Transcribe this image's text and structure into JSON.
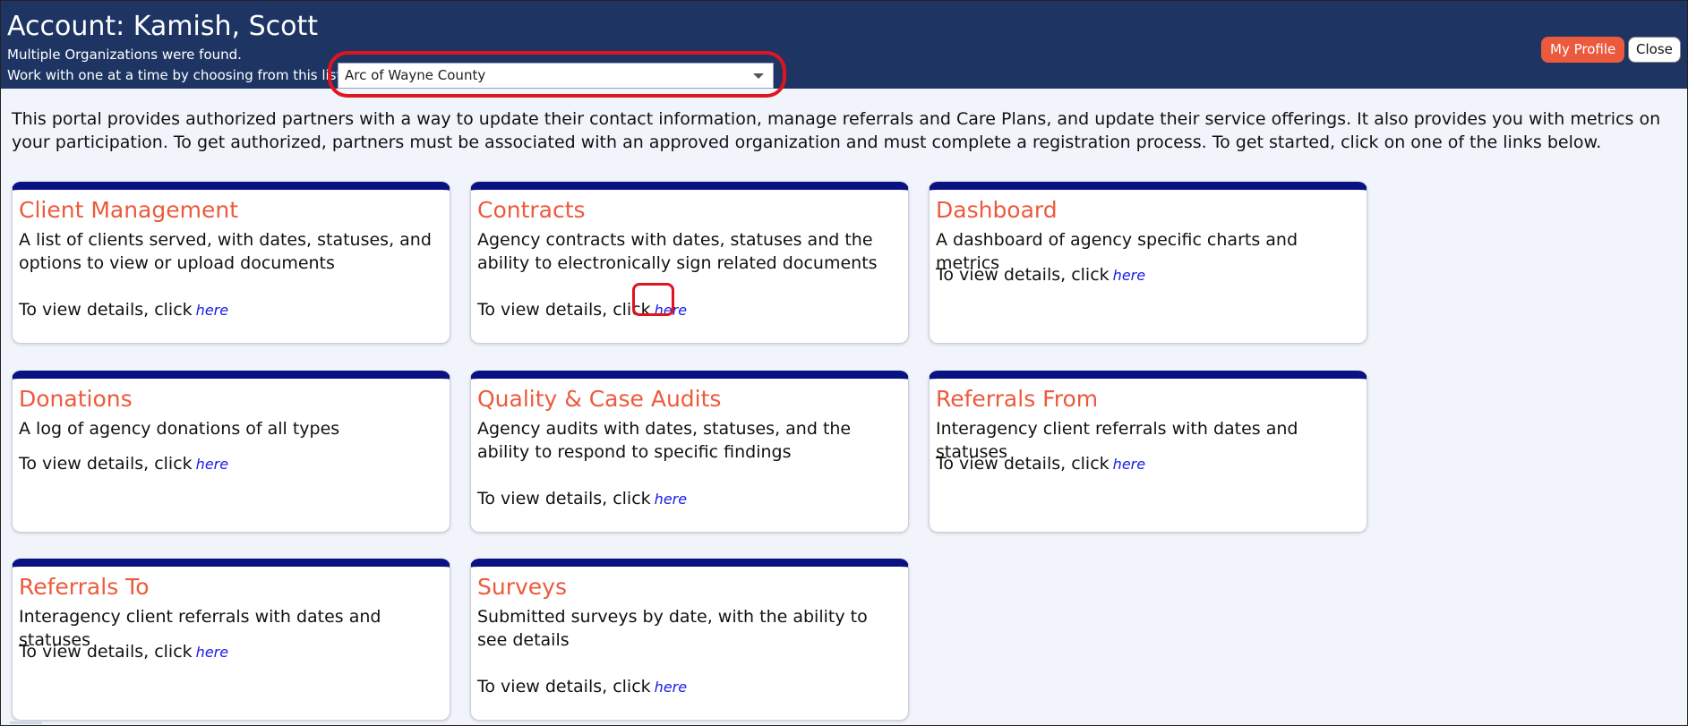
{
  "header": {
    "title": "Account: Kamish, Scott",
    "line1": "Multiple Organizations were found.",
    "line2": "Work with one at a time by choosing from this list",
    "org_select_value": "Arc of Wayne County",
    "my_profile_label": "My Profile",
    "close_label": "Close",
    "background_color": "#1e3563"
  },
  "intro": "This portal provides authorized partners with a way to update their contact information, manage referrals and Care Plans, and update their service offerings. It also provides you with metrics on your participation. To get authorized, partners must be associated with an approved organization and must complete a registration process. To get started, click on one of the links below.",
  "link_label": "here",
  "cards": [
    {
      "title": "Client Management",
      "description": "A list of clients served, with dates, statuses, and options to view or upload documents",
      "details_text": "To view details, click"
    },
    {
      "title": "Contracts",
      "description": "Agency contracts with dates, statuses and the ability to electronically sign related documents",
      "details_text": "To view details, click"
    },
    {
      "title": "Dashboard",
      "description": "A dashboard of agency specific charts and metrics",
      "details_text": "To view details, click"
    },
    {
      "title": "Donations",
      "description": "A log of agency donations of all types",
      "details_text": "To view details, click"
    },
    {
      "title": "Quality & Case Audits",
      "description": "Agency audits with dates, statuses, and the ability to respond to specific findings",
      "details_text": "To view details, click"
    },
    {
      "title": "Referrals From",
      "description": "Interagency client referrals with dates and statuses",
      "details_text": "To view details, click"
    },
    {
      "title": "Referrals To",
      "description": "Interagency client referrals with dates and statuses",
      "details_text": "To view details, click"
    },
    {
      "title": "Surveys",
      "description": "Submitted surveys by date, with the ability to see details",
      "details_text": "To view details, click"
    }
  ],
  "colors": {
    "card_top_border": "#0a1282",
    "card_title": "#ec5a3d",
    "link": "#1a1ae6",
    "annotation": "#e0141e"
  }
}
